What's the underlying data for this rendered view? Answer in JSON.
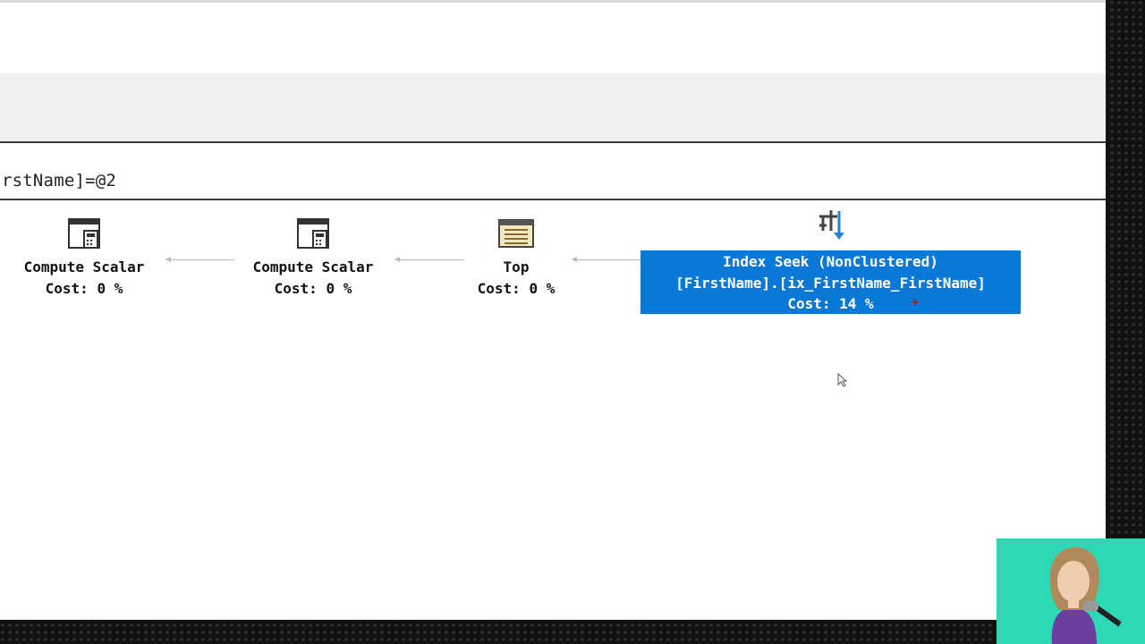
{
  "query": {
    "text": "rstName]=@2"
  },
  "plan": {
    "operators": [
      {
        "name": "Compute Scalar",
        "cost": "Cost: 0 %",
        "icon": "compute-scalar-icon"
      },
      {
        "name": "Compute Scalar",
        "cost": "Cost: 0 %",
        "icon": "compute-scalar-icon"
      },
      {
        "name": "Top",
        "cost": "Cost: 0 %",
        "icon": "top-operator-icon"
      }
    ],
    "selected_operator": {
      "name": "Index Seek (NonClustered)",
      "object": "[FirstName].[ix_FirstName_FirstName]",
      "cost": "Cost: 14 %",
      "icon": "index-seek-icon",
      "warning_mark": "+"
    }
  },
  "colors": {
    "selection": "#0a78d7",
    "warning": "#d01010",
    "webcam_bg": "#2fd8b4"
  }
}
